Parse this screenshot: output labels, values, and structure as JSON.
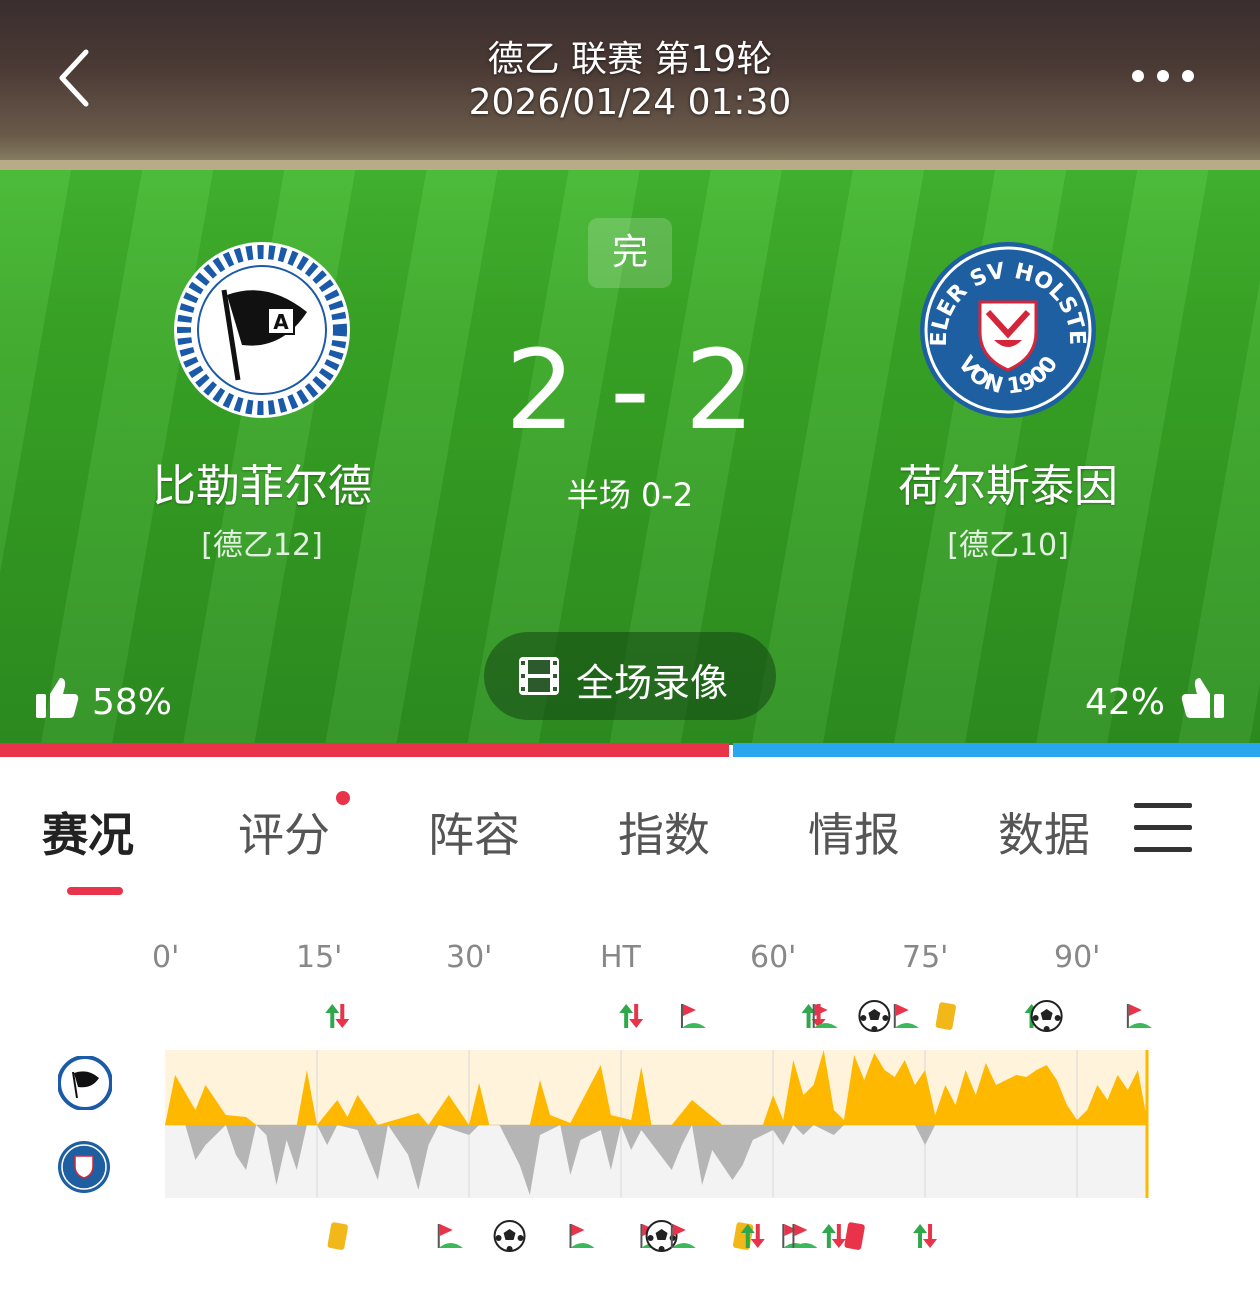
{
  "header": {
    "league_round": "德乙 联赛 第19轮",
    "datetime": "2026/01/24 01:30"
  },
  "match": {
    "status": "完",
    "score": "2 - 2",
    "halftime": "半场 0-2",
    "home": {
      "name": "比勒菲尔德",
      "rank": "[德乙12]",
      "vote_pct": "58%",
      "color": "#e8334a"
    },
    "away": {
      "name": "荷尔斯泰因",
      "rank": "[德乙10]",
      "vote_pct": "42%",
      "color": "#2aa6ef",
      "badge_text": "KIELER SV HOLSTEIN",
      "badge_year": "VON 1900"
    },
    "replay_label": "全场录像"
  },
  "tabs": [
    {
      "label": "赛况",
      "active": true
    },
    {
      "label": "评分",
      "has_dot": true
    },
    {
      "label": "阵容"
    },
    {
      "label": "指数"
    },
    {
      "label": "情报"
    },
    {
      "label": "数据"
    }
  ],
  "timeline": {
    "minute_labels": [
      "0'",
      "15'",
      "30'",
      "HT",
      "60'",
      "75'",
      "90'"
    ],
    "home_color": "#ffb800",
    "away_color": "#b5b5b5",
    "home_events": [
      {
        "minute": 17,
        "type": "substitution"
      },
      {
        "minute": 46,
        "type": "substitution"
      },
      {
        "minute": 52,
        "type": "corner"
      },
      {
        "minute": 64,
        "type": "substitution"
      },
      {
        "minute": 65,
        "type": "corner"
      },
      {
        "minute": 70,
        "type": "goal"
      },
      {
        "minute": 73,
        "type": "corner"
      },
      {
        "minute": 77,
        "type": "yellow-card"
      },
      {
        "minute": 86,
        "type": "substitution"
      },
      {
        "minute": 87,
        "type": "goal"
      },
      {
        "minute": 96,
        "type": "corner"
      }
    ],
    "away_events": [
      {
        "minute": 17,
        "type": "yellow-card"
      },
      {
        "minute": 28,
        "type": "corner"
      },
      {
        "minute": 34,
        "type": "goal"
      },
      {
        "minute": 41,
        "type": "corner"
      },
      {
        "minute": 48,
        "type": "corner"
      },
      {
        "minute": 49,
        "type": "goal"
      },
      {
        "minute": 51,
        "type": "corner"
      },
      {
        "minute": 57,
        "type": "yellow-card"
      },
      {
        "minute": 58,
        "type": "substitution"
      },
      {
        "minute": 62,
        "type": "corner"
      },
      {
        "minute": 63,
        "type": "corner"
      },
      {
        "minute": 66,
        "type": "substitution"
      },
      {
        "minute": 68,
        "type": "red-card"
      },
      {
        "minute": 75,
        "type": "substitution"
      }
    ]
  },
  "icons": {
    "back": "chevron-left-icon",
    "more": "more-dots-icon",
    "menu": "hamburger-menu-icon",
    "replay": "film-icon",
    "thumb": "thumbs-up-icon"
  }
}
